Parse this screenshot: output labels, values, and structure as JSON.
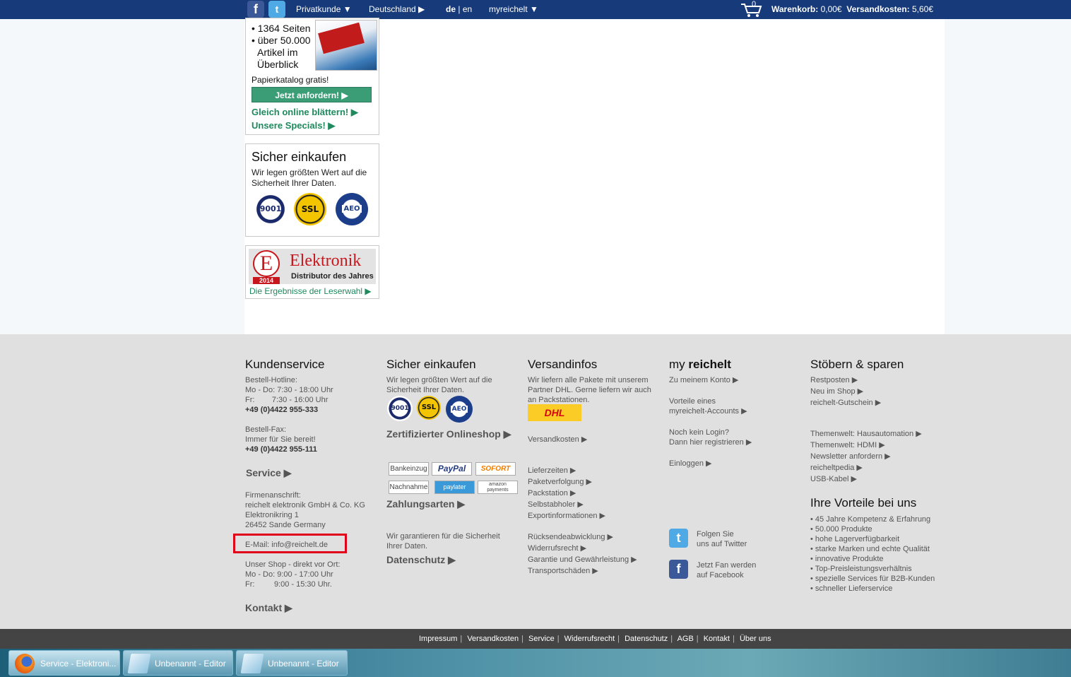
{
  "topbar": {
    "customer_type": "Privatkunde ▼",
    "country": "Deutschland ▶",
    "lang_de": "de",
    "lang_sep": " | ",
    "lang_en": "en",
    "myreichelt": "myreichelt ▼",
    "cart_count": "0",
    "cart_label": "Warenkorb:",
    "cart_value": "0,00€",
    "shipping_label": "Versandkosten:",
    "shipping_value": "5,60€",
    "colors": {
      "bar": "#163a7a"
    }
  },
  "catalog_box": {
    "bullet1": "• 1364 Seiten",
    "bullet2": "• über 50.000",
    "bullet2b": "Artikel im",
    "bullet2c": "Überblick",
    "free_text": "Papierkatalog gratis!",
    "order_button": "Jetzt anfordern! ▶",
    "browse_link": "Gleich online blättern! ▶",
    "specials_link": "Unsere Specials! ▶"
  },
  "secure_box": {
    "title": "Sicher einkaufen",
    "text": "Wir legen größten Wert auf die Sicherheit Ihrer Daten.",
    "seal_iso": "9001",
    "seal_ssl": "SSL",
    "seal_aeo": "AEO"
  },
  "award_box": {
    "logo_letter": "E",
    "year": "2014",
    "brand": "Elektronik",
    "subtitle": "Distributor des Jahres",
    "link": "Die Ergebnisse der Leserwahl ▶"
  },
  "footer": {
    "kundenservice": {
      "title": "Kundenservice",
      "hotline_label": "Bestell-Hotline:",
      "hotline_mofr": "Mo - Do: 7:30 - 18:00 Uhr",
      "hotline_fr": "Fr:        7:30 - 16:00 Uhr",
      "hotline_phone": "+49 (0)4422 955-333",
      "fax_label": "Bestell-Fax:",
      "fax_text": "Immer für Sie bereit!",
      "fax_number": "+49 (0)4422 955-111",
      "service_link": "Service ▶",
      "address_label": "Firmenanschrift:",
      "address_company": "reichelt elektronik GmbH & Co. KG",
      "address_street": "Elektronikring 1",
      "address_city": "26452 Sande Germany",
      "email": "E-Mail: info@reichelt.de",
      "shop_label": "Unser Shop - direkt vor Ort:",
      "shop_mofr": "Mo - Do: 9:00 - 17:00 Uhr",
      "shop_fr": "Fr:         9:00 - 15:30 Uhr.",
      "contact_link": "Kontakt ▶"
    },
    "sicher": {
      "title": "Sicher einkaufen",
      "text1": "Wir legen größten Wert auf die",
      "text2": "Sicherheit Ihrer Daten.",
      "cert_link": "Zertifizierter Onlineshop ▶",
      "pay1": "Bankeinzug",
      "pay2": "PayPal",
      "pay3": "SOFORT",
      "pay4": "Nachnahme",
      "pay5": "paylater",
      "pay6": "amazon payments",
      "payment_link": "Zahlungsarten ▶",
      "privacy_text1": "Wir garantieren für die Sicherheit",
      "privacy_text2": "Ihrer Daten.",
      "privacy_link": "Datenschutz ▶"
    },
    "versand": {
      "title": "Versandinfos",
      "text1": "Wir liefern alle Pakete mit unserem",
      "text2": "Partner DHL. Gerne liefern wir auch",
      "text3": "an Packstationen.",
      "dhl": "DHL",
      "links": [
        "Versandkosten ▶",
        "Lieferzeiten ▶",
        "Paketverfolgung ▶",
        "Packstation ▶",
        "Selbstabholer ▶",
        "Exportinformationen ▶",
        "Rücksendeabwicklung ▶",
        "Widerrufsrecht ▶",
        "Garantie und Gewährleistung ▶",
        "Transportschäden ▶"
      ]
    },
    "myreichelt": {
      "title_my": "my ",
      "title_brand": "reichelt",
      "account_link": "Zu meinem Konto ▶",
      "benefits1": "Vorteile eines",
      "benefits2": "myreichelt-Accounts ▶",
      "register1": "Noch kein Login?",
      "register2": "Dann hier registrieren ▶",
      "login_link": "Einloggen ▶",
      "twitter1": "Folgen Sie",
      "twitter2": "uns auf Twitter",
      "facebook1": "Jetzt Fan werden",
      "facebook2": "auf Facebook"
    },
    "stoebern": {
      "title": "Stöbern & sparen",
      "links1": [
        "Restposten ▶",
        "Neu im Shop ▶",
        "reichelt-Gutschein ▶"
      ],
      "links2": [
        "Themenwelt: Hausautomation ▶",
        "Themenwelt: HDMI ▶",
        "Newsletter anfordern ▶",
        "reicheltpedia ▶",
        "USB-Kabel ▶"
      ],
      "benefits_title": "Ihre Vorteile bei uns",
      "benefits": [
        "• 45 Jahre Kompetenz & Erfahrung",
        "• 50.000 Produkte",
        "• hohe Lagerverfügbarkeit",
        "• starke Marken und echte Qualität",
        "• innovative Produkte",
        "• Top-Preisleistungsverhältnis",
        "• spezielle Services für B2B-Kunden",
        "• schneller Lieferservice"
      ]
    }
  },
  "bottom_links": [
    "Impressum",
    "Versandkosten",
    "Service",
    "Widerrufsrecht",
    "Datenschutz",
    "AGB",
    "Kontakt",
    "Über uns"
  ],
  "taskbar": {
    "task1": "Service - Elektroni...",
    "task2": "Unbenannt - Editor",
    "task3": "Unbenannt - Editor"
  },
  "highlight_color": "#e0001a"
}
